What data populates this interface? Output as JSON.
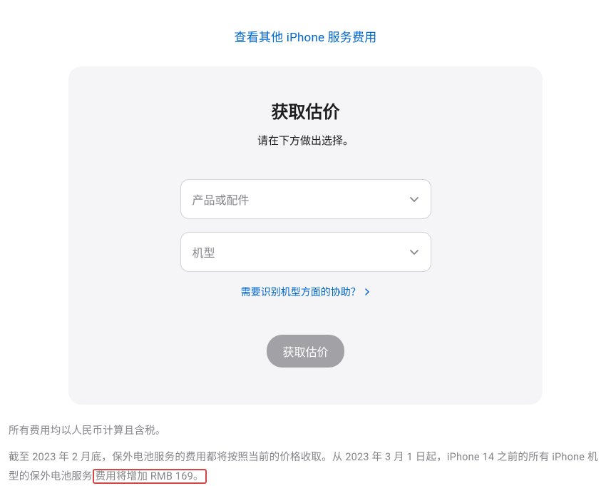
{
  "topLink": {
    "text": "查看其他 iPhone 服务费用"
  },
  "card": {
    "title": "获取估价",
    "subtitle": "请在下方做出选择。",
    "select1": {
      "placeholder": "产品或配件"
    },
    "select2": {
      "placeholder": "机型"
    },
    "helpLink": {
      "text": "需要识别机型方面的协助？"
    },
    "button": {
      "label": "获取估价"
    }
  },
  "footer": {
    "line1": "所有费用均以人民币计算且含税。",
    "line2_a": "截至 2023 年 2 月底，保外电池服务的费用都将按照当前的价格收取。从 2023 年 3 月 1 日起，iPhone 14 之前的所有 iPhone 机型的保外电池服务",
    "line2_b": "费用将增加 RMB 169。"
  }
}
